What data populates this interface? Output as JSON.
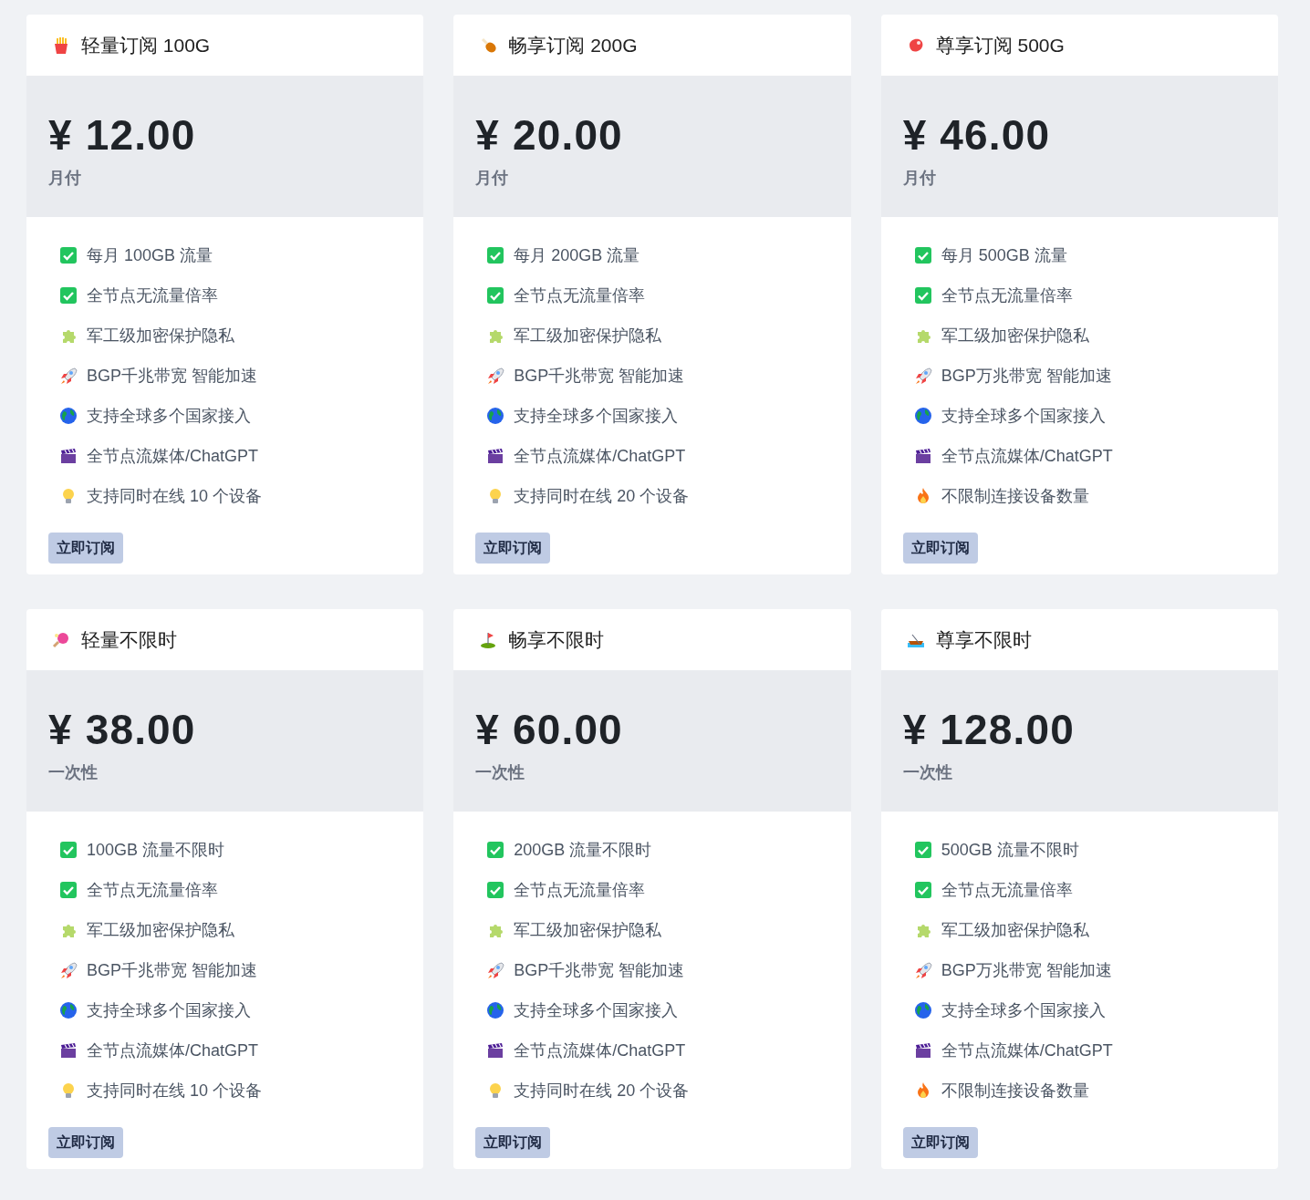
{
  "plans": [
    {
      "kind": "fries",
      "title": "轻量订阅 100G",
      "price": "¥ 12.00",
      "period": "月付",
      "button": "立即订阅",
      "features": [
        {
          "kind": "check",
          "text": "每月 100GB 流量"
        },
        {
          "kind": "check",
          "text": "全节点无流量倍率"
        },
        {
          "kind": "puzzle",
          "text": "军工级加密保护隐私"
        },
        {
          "kind": "rocket",
          "text": "BGP千兆带宽 智能加速"
        },
        {
          "kind": "globe",
          "text": "支持全球多个国家接入"
        },
        {
          "kind": "clapper",
          "text": "全节点流媒体/ChatGPT"
        },
        {
          "kind": "bulb",
          "text": "支持同时在线 10 个设备"
        }
      ]
    },
    {
      "kind": "drumstick",
      "title": "畅享订阅 200G",
      "price": "¥ 20.00",
      "period": "月付",
      "button": "立即订阅",
      "features": [
        {
          "kind": "check",
          "text": "每月 200GB 流量"
        },
        {
          "kind": "check",
          "text": "全节点无流量倍率"
        },
        {
          "kind": "puzzle",
          "text": "军工级加密保护隐私"
        },
        {
          "kind": "rocket",
          "text": "BGP千兆带宽 智能加速"
        },
        {
          "kind": "globe",
          "text": "支持全球多个国家接入"
        },
        {
          "kind": "clapper",
          "text": "全节点流媒体/ChatGPT"
        },
        {
          "kind": "bulb",
          "text": "支持同时在线 20 个设备"
        }
      ]
    },
    {
      "kind": "meat",
      "title": "尊享订阅 500G",
      "price": "¥ 46.00",
      "period": "月付",
      "button": "立即订阅",
      "features": [
        {
          "kind": "check",
          "text": "每月 500GB 流量"
        },
        {
          "kind": "check",
          "text": "全节点无流量倍率"
        },
        {
          "kind": "puzzle",
          "text": "军工级加密保护隐私"
        },
        {
          "kind": "rocket",
          "text": "BGP万兆带宽 智能加速"
        },
        {
          "kind": "globe",
          "text": "支持全球多个国家接入"
        },
        {
          "kind": "clapper",
          "text": "全节点流媒体/ChatGPT"
        },
        {
          "kind": "flame",
          "text": "不限制连接设备数量"
        }
      ]
    },
    {
      "kind": "pingpong",
      "title": "轻量不限时",
      "price": "¥ 38.00",
      "period": "一次性",
      "button": "立即订阅",
      "features": [
        {
          "kind": "check",
          "text": "100GB 流量不限时"
        },
        {
          "kind": "check",
          "text": "全节点无流量倍率"
        },
        {
          "kind": "puzzle",
          "text": "军工级加密保护隐私"
        },
        {
          "kind": "rocket",
          "text": "BGP千兆带宽 智能加速"
        },
        {
          "kind": "globe",
          "text": "支持全球多个国家接入"
        },
        {
          "kind": "clapper",
          "text": "全节点流媒体/ChatGPT"
        },
        {
          "kind": "bulb",
          "text": "支持同时在线 10 个设备"
        }
      ]
    },
    {
      "kind": "golf",
      "title": "畅享不限时",
      "price": "¥ 60.00",
      "period": "一次性",
      "button": "立即订阅",
      "features": [
        {
          "kind": "check",
          "text": "200GB 流量不限时"
        },
        {
          "kind": "check",
          "text": "全节点无流量倍率"
        },
        {
          "kind": "puzzle",
          "text": "军工级加密保护隐私"
        },
        {
          "kind": "rocket",
          "text": "BGP千兆带宽 智能加速"
        },
        {
          "kind": "globe",
          "text": "支持全球多个国家接入"
        },
        {
          "kind": "clapper",
          "text": "全节点流媒体/ChatGPT"
        },
        {
          "kind": "bulb",
          "text": "支持同时在线 20 个设备"
        }
      ]
    },
    {
      "kind": "boat",
      "title": "尊享不限时",
      "price": "¥ 128.00",
      "period": "一次性",
      "button": "立即订阅",
      "features": [
        {
          "kind": "check",
          "text": "500GB 流量不限时"
        },
        {
          "kind": "check",
          "text": "全节点无流量倍率"
        },
        {
          "kind": "puzzle",
          "text": "军工级加密保护隐私"
        },
        {
          "kind": "rocket",
          "text": "BGP万兆带宽 智能加速"
        },
        {
          "kind": "globe",
          "text": "支持全球多个国家接入"
        },
        {
          "kind": "clapper",
          "text": "全节点流媒体/ChatGPT"
        },
        {
          "kind": "flame",
          "text": "不限制连接设备数量"
        }
      ]
    }
  ]
}
